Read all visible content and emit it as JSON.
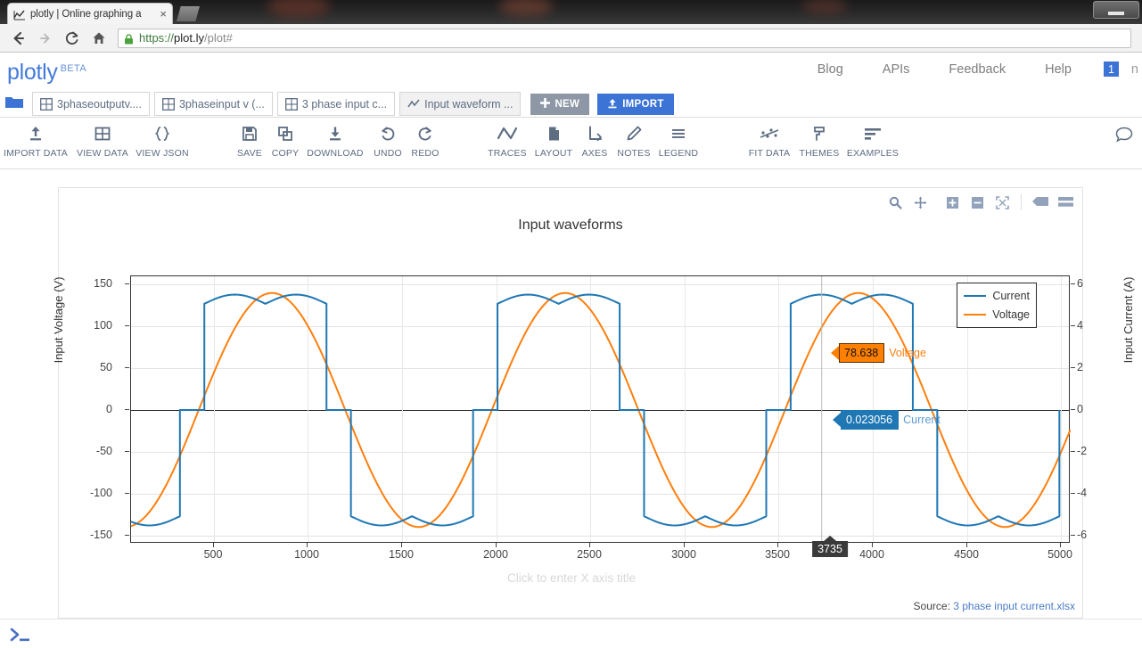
{
  "browser": {
    "tab_title": "plotly | Online graphing a",
    "tab_favicon": "chart-line-icon",
    "close_label": "×",
    "url_scheme": "https://",
    "url_host": "plot.ly",
    "url_rest": "/plot#",
    "back_label": "←",
    "forward_label": "→",
    "reload_label": "⟳",
    "home_label": "⌂"
  },
  "header": {
    "brand": "plotly",
    "beta": "BETA",
    "nav": [
      "Blog",
      "APIs",
      "Feedback",
      "Help"
    ],
    "notifications": "1",
    "truncated": "n"
  },
  "tabstrip": {
    "files": [
      {
        "label": "3phaseoutputv....",
        "icon": "grid-icon",
        "active": false
      },
      {
        "label": "3phaseinput v (...",
        "icon": "grid-icon",
        "active": false
      },
      {
        "label": "3 phase input c...",
        "icon": "grid-icon",
        "active": false
      },
      {
        "label": "Input waveform ...",
        "icon": "chart-line-icon",
        "active": true
      }
    ],
    "new_label": "NEW",
    "import_label": "IMPORT"
  },
  "toolbar": {
    "items": [
      {
        "label": "IMPORT DATA",
        "icon": "upload-icon",
        "x": 0
      },
      {
        "label": "VIEW DATA",
        "icon": "grid-icon",
        "x": 75
      },
      {
        "label": "VIEW JSON",
        "icon": "braces-icon",
        "x": 142
      },
      {
        "label": "SAVE",
        "icon": "floppy-icon",
        "x": 240
      },
      {
        "label": "COPY",
        "icon": "copy-icon",
        "x": 280
      },
      {
        "label": "DOWNLOAD",
        "icon": "download-icon",
        "x": 336
      },
      {
        "label": "UNDO",
        "icon": "undo-icon",
        "x": 395
      },
      {
        "label": "REDO",
        "icon": "redo-icon",
        "x": 437
      },
      {
        "label": "TRACES",
        "icon": "zigzag-icon",
        "x": 529
      },
      {
        "label": "LAYOUT",
        "icon": "page-icon",
        "x": 581
      },
      {
        "label": "AXES",
        "icon": "axes-icon",
        "x": 627
      },
      {
        "label": "NOTES",
        "icon": "pencil-icon",
        "x": 671
      },
      {
        "label": "LEGEND",
        "icon": "lines-icon",
        "x": 721
      },
      {
        "label": "FIT DATA",
        "icon": "fit-data-icon",
        "x": 823
      },
      {
        "label": "THEMES",
        "icon": "paint-roller-icon",
        "x": 879
      },
      {
        "label": "EXAMPLES",
        "icon": "bars-icon",
        "x": 939
      }
    ],
    "chat_icon": "chat-bubble-icon"
  },
  "modebar": {
    "buttons": [
      "zoom-icon",
      "pan-icon",
      "zoom-in-icon",
      "zoom-out-icon",
      "autoscale-icon",
      "hover-compare-icon",
      "hover-closest-icon"
    ]
  },
  "chart_data": {
    "type": "line",
    "title": "Input waveforms",
    "xlabel": "Click to enter X axis title",
    "ylabel": "Input Voltage (V)",
    "y2label": "Input Current (A)",
    "xlim": [
      60,
      5060
    ],
    "ylim": [
      -160,
      160
    ],
    "y2lim": [
      -6.6,
      6.6
    ],
    "xticks": [
      500,
      1000,
      1500,
      2000,
      2500,
      3000,
      3500,
      4000,
      4500,
      5000
    ],
    "yticks": [
      150,
      100,
      50,
      0,
      -50,
      -100,
      -150
    ],
    "y2ticks": [
      6,
      4,
      2,
      0,
      -2,
      -4,
      -6
    ],
    "grid": true,
    "legend_position": "top-right",
    "series": [
      {
        "name": "Current",
        "color": "#1f77b4",
        "axis": "y2",
        "peak": 5.7,
        "trough": -5.7
      },
      {
        "name": "Voltage",
        "color": "#ff7f0e",
        "axis": "y",
        "amplitude": 140,
        "period": 1560
      }
    ],
    "annotations": [
      {
        "name": "Voltage",
        "value": "78.638",
        "color": "#ff8000",
        "x": 3735,
        "y": 78.638
      },
      {
        "name": "Current",
        "value": "0.023056",
        "color": "#1f77b4",
        "x": 3735,
        "y": 0.023056
      }
    ],
    "hover_x": "3735",
    "source_prefix": "Source:",
    "source_file": "3 phase input current.xlsx"
  },
  "console": {
    "icon": "terminal-prompt-icon"
  }
}
